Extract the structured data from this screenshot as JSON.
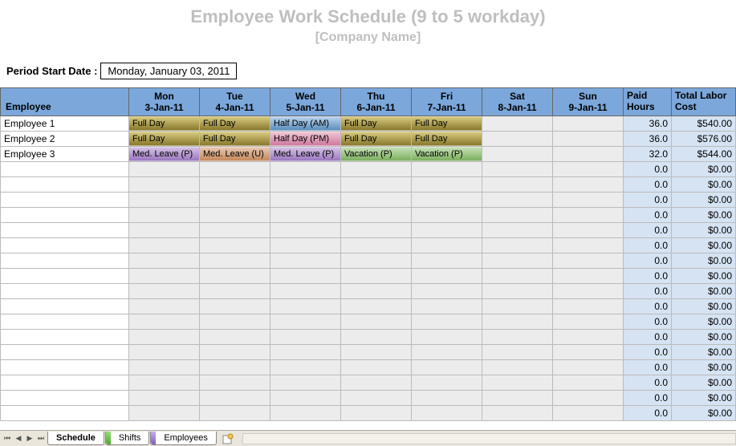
{
  "title": "Employee Work Schedule (9 to 5  workday)",
  "subtitle": "[Company Name]",
  "period_label": "Period Start Date :",
  "period_value": "Monday, January 03, 2011",
  "headers": {
    "employee": "Employee",
    "days": [
      {
        "name": "Mon",
        "date": "3-Jan-11"
      },
      {
        "name": "Tue",
        "date": "4-Jan-11"
      },
      {
        "name": "Wed",
        "date": "5-Jan-11"
      },
      {
        "name": "Thu",
        "date": "6-Jan-11"
      },
      {
        "name": "Fri",
        "date": "7-Jan-11"
      },
      {
        "name": "Sat",
        "date": "8-Jan-11"
      },
      {
        "name": "Sun",
        "date": "9-Jan-11"
      }
    ],
    "paid_hours": "Paid Hours",
    "total_cost": "Total Labor Cost"
  },
  "rows": [
    {
      "emp": "Employee 1",
      "shifts": [
        {
          "t": "Full Day",
          "c": "fullday"
        },
        {
          "t": "Full Day",
          "c": "fullday"
        },
        {
          "t": "Half Day (AM)",
          "c": "halfam"
        },
        {
          "t": "Full Day",
          "c": "fullday"
        },
        {
          "t": "Full Day",
          "c": "fullday"
        },
        {
          "t": "",
          "c": ""
        },
        {
          "t": "",
          "c": ""
        }
      ],
      "hours": "36.0",
      "cost": "$540.00"
    },
    {
      "emp": "Employee 2",
      "shifts": [
        {
          "t": "Full Day",
          "c": "fullday"
        },
        {
          "t": "Full Day",
          "c": "fullday"
        },
        {
          "t": "Half Day (PM)",
          "c": "halfpm"
        },
        {
          "t": "Full Day",
          "c": "fullday"
        },
        {
          "t": "Full Day",
          "c": "fullday"
        },
        {
          "t": "",
          "c": ""
        },
        {
          "t": "",
          "c": ""
        }
      ],
      "hours": "36.0",
      "cost": "$576.00"
    },
    {
      "emp": "Employee 3",
      "shifts": [
        {
          "t": "Med. Leave (P)",
          "c": "medp"
        },
        {
          "t": "Med. Leave (U)",
          "c": "medu"
        },
        {
          "t": "Med. Leave (P)",
          "c": "medp"
        },
        {
          "t": "Vacation (P)",
          "c": "vac"
        },
        {
          "t": "Vacation (P)",
          "c": "vac"
        },
        {
          "t": "",
          "c": ""
        },
        {
          "t": "",
          "c": ""
        }
      ],
      "hours": "32.0",
      "cost": "$544.00"
    },
    {
      "emp": "",
      "shifts": [
        {
          "t": "",
          "c": ""
        },
        {
          "t": "",
          "c": ""
        },
        {
          "t": "",
          "c": ""
        },
        {
          "t": "",
          "c": ""
        },
        {
          "t": "",
          "c": ""
        },
        {
          "t": "",
          "c": ""
        },
        {
          "t": "",
          "c": ""
        }
      ],
      "hours": "0.0",
      "cost": "$0.00"
    },
    {
      "emp": "",
      "shifts": [
        {
          "t": "",
          "c": ""
        },
        {
          "t": "",
          "c": ""
        },
        {
          "t": "",
          "c": ""
        },
        {
          "t": "",
          "c": ""
        },
        {
          "t": "",
          "c": ""
        },
        {
          "t": "",
          "c": ""
        },
        {
          "t": "",
          "c": ""
        }
      ],
      "hours": "0.0",
      "cost": "$0.00"
    },
    {
      "emp": "",
      "shifts": [
        {
          "t": "",
          "c": ""
        },
        {
          "t": "",
          "c": ""
        },
        {
          "t": "",
          "c": ""
        },
        {
          "t": "",
          "c": ""
        },
        {
          "t": "",
          "c": ""
        },
        {
          "t": "",
          "c": ""
        },
        {
          "t": "",
          "c": ""
        }
      ],
      "hours": "0.0",
      "cost": "$0.00"
    },
    {
      "emp": "",
      "shifts": [
        {
          "t": "",
          "c": ""
        },
        {
          "t": "",
          "c": ""
        },
        {
          "t": "",
          "c": ""
        },
        {
          "t": "",
          "c": ""
        },
        {
          "t": "",
          "c": ""
        },
        {
          "t": "",
          "c": ""
        },
        {
          "t": "",
          "c": ""
        }
      ],
      "hours": "0.0",
      "cost": "$0.00"
    },
    {
      "emp": "",
      "shifts": [
        {
          "t": "",
          "c": ""
        },
        {
          "t": "",
          "c": ""
        },
        {
          "t": "",
          "c": ""
        },
        {
          "t": "",
          "c": ""
        },
        {
          "t": "",
          "c": ""
        },
        {
          "t": "",
          "c": ""
        },
        {
          "t": "",
          "c": ""
        }
      ],
      "hours": "0.0",
      "cost": "$0.00"
    },
    {
      "emp": "",
      "shifts": [
        {
          "t": "",
          "c": ""
        },
        {
          "t": "",
          "c": ""
        },
        {
          "t": "",
          "c": ""
        },
        {
          "t": "",
          "c": ""
        },
        {
          "t": "",
          "c": ""
        },
        {
          "t": "",
          "c": ""
        },
        {
          "t": "",
          "c": ""
        }
      ],
      "hours": "0.0",
      "cost": "$0.00"
    },
    {
      "emp": "",
      "shifts": [
        {
          "t": "",
          "c": ""
        },
        {
          "t": "",
          "c": ""
        },
        {
          "t": "",
          "c": ""
        },
        {
          "t": "",
          "c": ""
        },
        {
          "t": "",
          "c": ""
        },
        {
          "t": "",
          "c": ""
        },
        {
          "t": "",
          "c": ""
        }
      ],
      "hours": "0.0",
      "cost": "$0.00"
    },
    {
      "emp": "",
      "shifts": [
        {
          "t": "",
          "c": ""
        },
        {
          "t": "",
          "c": ""
        },
        {
          "t": "",
          "c": ""
        },
        {
          "t": "",
          "c": ""
        },
        {
          "t": "",
          "c": ""
        },
        {
          "t": "",
          "c": ""
        },
        {
          "t": "",
          "c": ""
        }
      ],
      "hours": "0.0",
      "cost": "$0.00"
    },
    {
      "emp": "",
      "shifts": [
        {
          "t": "",
          "c": ""
        },
        {
          "t": "",
          "c": ""
        },
        {
          "t": "",
          "c": ""
        },
        {
          "t": "",
          "c": ""
        },
        {
          "t": "",
          "c": ""
        },
        {
          "t": "",
          "c": ""
        },
        {
          "t": "",
          "c": ""
        }
      ],
      "hours": "0.0",
      "cost": "$0.00"
    },
    {
      "emp": "",
      "shifts": [
        {
          "t": "",
          "c": ""
        },
        {
          "t": "",
          "c": ""
        },
        {
          "t": "",
          "c": ""
        },
        {
          "t": "",
          "c": ""
        },
        {
          "t": "",
          "c": ""
        },
        {
          "t": "",
          "c": ""
        },
        {
          "t": "",
          "c": ""
        }
      ],
      "hours": "0.0",
      "cost": "$0.00"
    },
    {
      "emp": "",
      "shifts": [
        {
          "t": "",
          "c": ""
        },
        {
          "t": "",
          "c": ""
        },
        {
          "t": "",
          "c": ""
        },
        {
          "t": "",
          "c": ""
        },
        {
          "t": "",
          "c": ""
        },
        {
          "t": "",
          "c": ""
        },
        {
          "t": "",
          "c": ""
        }
      ],
      "hours": "0.0",
      "cost": "$0.00"
    },
    {
      "emp": "",
      "shifts": [
        {
          "t": "",
          "c": ""
        },
        {
          "t": "",
          "c": ""
        },
        {
          "t": "",
          "c": ""
        },
        {
          "t": "",
          "c": ""
        },
        {
          "t": "",
          "c": ""
        },
        {
          "t": "",
          "c": ""
        },
        {
          "t": "",
          "c": ""
        }
      ],
      "hours": "0.0",
      "cost": "$0.00"
    },
    {
      "emp": "",
      "shifts": [
        {
          "t": "",
          "c": ""
        },
        {
          "t": "",
          "c": ""
        },
        {
          "t": "",
          "c": ""
        },
        {
          "t": "",
          "c": ""
        },
        {
          "t": "",
          "c": ""
        },
        {
          "t": "",
          "c": ""
        },
        {
          "t": "",
          "c": ""
        }
      ],
      "hours": "0.0",
      "cost": "$0.00"
    },
    {
      "emp": "",
      "shifts": [
        {
          "t": "",
          "c": ""
        },
        {
          "t": "",
          "c": ""
        },
        {
          "t": "",
          "c": ""
        },
        {
          "t": "",
          "c": ""
        },
        {
          "t": "",
          "c": ""
        },
        {
          "t": "",
          "c": ""
        },
        {
          "t": "",
          "c": ""
        }
      ],
      "hours": "0.0",
      "cost": "$0.00"
    },
    {
      "emp": "",
      "shifts": [
        {
          "t": "",
          "c": ""
        },
        {
          "t": "",
          "c": ""
        },
        {
          "t": "",
          "c": ""
        },
        {
          "t": "",
          "c": ""
        },
        {
          "t": "",
          "c": ""
        },
        {
          "t": "",
          "c": ""
        },
        {
          "t": "",
          "c": ""
        }
      ],
      "hours": "0.0",
      "cost": "$0.00"
    },
    {
      "emp": "",
      "shifts": [
        {
          "t": "",
          "c": ""
        },
        {
          "t": "",
          "c": ""
        },
        {
          "t": "",
          "c": ""
        },
        {
          "t": "",
          "c": ""
        },
        {
          "t": "",
          "c": ""
        },
        {
          "t": "",
          "c": ""
        },
        {
          "t": "",
          "c": ""
        }
      ],
      "hours": "0.0",
      "cost": "$0.00"
    },
    {
      "emp": "",
      "shifts": [
        {
          "t": "",
          "c": ""
        },
        {
          "t": "",
          "c": ""
        },
        {
          "t": "",
          "c": ""
        },
        {
          "t": "",
          "c": ""
        },
        {
          "t": "",
          "c": ""
        },
        {
          "t": "",
          "c": ""
        },
        {
          "t": "",
          "c": ""
        }
      ],
      "hours": "0.0",
      "cost": "$0.00"
    }
  ],
  "tabs": {
    "t0": "Schedule",
    "t1": "Shifts",
    "t2": "Employees"
  }
}
